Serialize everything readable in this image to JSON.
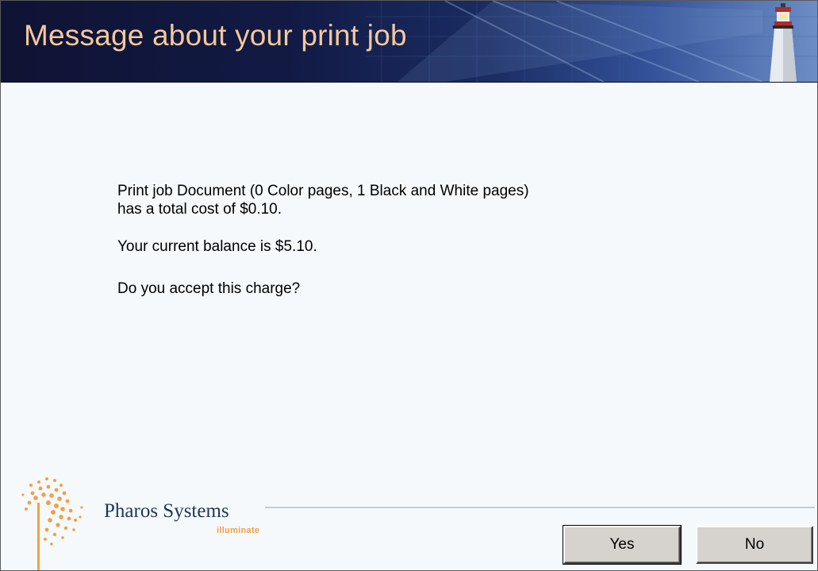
{
  "window": {
    "title": "Message about your print job"
  },
  "message": {
    "line1": "Print job Document (0 Color pages, 1 Black and White pages)",
    "line2": "has a total cost of $0.10.",
    "balance": "Your current balance is $5.10.",
    "question": "Do you accept this charge?"
  },
  "branding": {
    "name": "Pharos Systems",
    "tagline": "illuminate",
    "icon": "sunburst-logo-icon",
    "banner_icon": "lighthouse-icon"
  },
  "buttons": {
    "yes_label": "Yes",
    "no_label": "No"
  },
  "colors": {
    "banner_dark": "#0f1334",
    "banner_light": "#6d8dc6",
    "title_text": "#f3c89a",
    "logo_orange": "#f0a046",
    "logo_navy": "#1f3654",
    "button_face": "#d6d3ce"
  }
}
